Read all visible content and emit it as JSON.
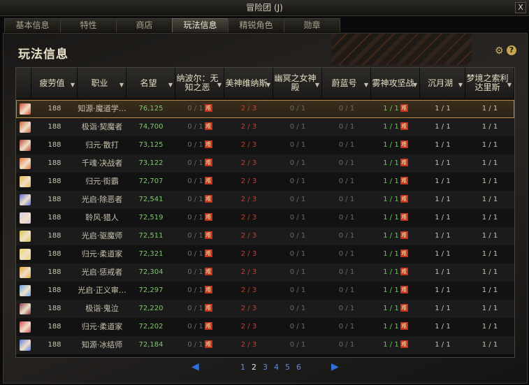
{
  "window": {
    "title": "冒险团 (J)",
    "close_label": "X"
  },
  "tabs": [
    {
      "label": "基本信息",
      "active": false
    },
    {
      "label": "特性",
      "active": false
    },
    {
      "label": "商店",
      "active": false
    },
    {
      "label": "玩法信息",
      "active": true
    },
    {
      "label": "精锐角色",
      "active": false
    },
    {
      "label": "勋章",
      "active": false
    }
  ],
  "panel": {
    "title": "玩法信息",
    "help_label": "?",
    "gear_icon": "gear-icon"
  },
  "columns": [
    {
      "label": "",
      "sortable": false
    },
    {
      "label": "疲劳值",
      "sortable": true
    },
    {
      "label": "职业",
      "sortable": true
    },
    {
      "label": "名望",
      "sortable": true
    },
    {
      "label": "纳波尔：无知之恶",
      "sortable": true
    },
    {
      "label": "美神维纳斯",
      "sortable": true
    },
    {
      "label": "幽冥之女神殿",
      "sortable": true
    },
    {
      "label": "蔚蓝号",
      "sortable": true
    },
    {
      "label": "雾神攻坚战",
      "sortable": true
    },
    {
      "label": "沉月湖",
      "sortable": true
    },
    {
      "label": "梦境之索利达里斯",
      "sortable": true
    }
  ],
  "badge_char": "难",
  "rows": [
    {
      "avatar_color": "#d84a3a",
      "fatigue": "188",
      "job": "知源·魔道学…",
      "fame": "76,125",
      "naboer": "0 / 1",
      "venus": "2 / 3",
      "hades": "0 / 1",
      "azure": "0 / 1",
      "mist": "1 / 1",
      "moonlake": "1 / 1",
      "dream": "1 / 1",
      "selected": true
    },
    {
      "avatar_color": "#c8643a",
      "fatigue": "188",
      "job": "极诣·契魔者",
      "fame": "74,700",
      "naboer": "0 / 1",
      "venus": "2 / 3",
      "hades": "0 / 1",
      "azure": "0 / 1",
      "mist": "1 / 1",
      "moonlake": "1 / 1",
      "dream": "1 / 1",
      "selected": false
    },
    {
      "avatar_color": "#b8483a",
      "fatigue": "188",
      "job": "归元·散打",
      "fame": "73,125",
      "naboer": "0 / 1",
      "venus": "2 / 3",
      "hades": "0 / 1",
      "azure": "0 / 1",
      "mist": "1 / 1",
      "moonlake": "1 / 1",
      "dream": "1 / 1",
      "selected": false
    },
    {
      "avatar_color": "#e07a3a",
      "fatigue": "188",
      "job": "千魂·决战者",
      "fame": "73,122",
      "naboer": "0 / 1",
      "venus": "2 / 3",
      "hades": "0 / 1",
      "azure": "0 / 1",
      "mist": "1 / 1",
      "moonlake": "1 / 1",
      "dream": "1 / 1",
      "selected": false
    },
    {
      "avatar_color": "#e8b84a",
      "fatigue": "188",
      "job": "归元·街霸",
      "fame": "72,707",
      "naboer": "0 / 1",
      "venus": "2 / 3",
      "hades": "0 / 1",
      "azure": "0 / 1",
      "mist": "1 / 1",
      "moonlake": "1 / 1",
      "dream": "1 / 1",
      "selected": false
    },
    {
      "avatar_color": "#5a6ad8",
      "fatigue": "188",
      "job": "光启·除恶者",
      "fame": "72,541",
      "naboer": "0 / 1",
      "venus": "2 / 3",
      "hades": "0 / 1",
      "azure": "0 / 1",
      "mist": "1 / 1",
      "moonlake": "1 / 1",
      "dream": "1 / 1",
      "selected": false
    },
    {
      "avatar_color": "#d8c8e8",
      "fatigue": "188",
      "job": "聆风·猎人",
      "fame": "72,519",
      "naboer": "0 / 1",
      "venus": "2 / 3",
      "hades": "0 / 1",
      "azure": "0 / 1",
      "mist": "1 / 1",
      "moonlake": "1 / 1",
      "dream": "1 / 1",
      "selected": false
    },
    {
      "avatar_color": "#d8c84a",
      "fatigue": "188",
      "job": "光启·驱魔师",
      "fame": "72,511",
      "naboer": "0 / 1",
      "venus": "2 / 3",
      "hades": "0 / 1",
      "azure": "0 / 1",
      "mist": "1 / 1",
      "moonlake": "1 / 1",
      "dream": "1 / 1",
      "selected": false
    },
    {
      "avatar_color": "#e8d86a",
      "fatigue": "188",
      "job": "归元·柔道家",
      "fame": "72,321",
      "naboer": "0 / 1",
      "venus": "2 / 3",
      "hades": "0 / 1",
      "azure": "0 / 1",
      "mist": "1 / 1",
      "moonlake": "1 / 1",
      "dream": "1 / 1",
      "selected": false
    },
    {
      "avatar_color": "#e8a83a",
      "fatigue": "188",
      "job": "光启·惩戒者",
      "fame": "72,304",
      "naboer": "0 / 1",
      "venus": "2 / 3",
      "hades": "0 / 1",
      "azure": "0 / 1",
      "mist": "1 / 1",
      "moonlake": "1 / 1",
      "dream": "1 / 1",
      "selected": false
    },
    {
      "avatar_color": "#6aa8e8",
      "fatigue": "188",
      "job": "光启·正义审…",
      "fame": "72,297",
      "naboer": "0 / 1",
      "venus": "2 / 3",
      "hades": "0 / 1",
      "azure": "0 / 1",
      "mist": "1 / 1",
      "moonlake": "1 / 1",
      "dream": "1 / 1",
      "selected": false
    },
    {
      "avatar_color": "#8a3a4a",
      "fatigue": "188",
      "job": "极诣·鬼泣",
      "fame": "72,220",
      "naboer": "0 / 1",
      "venus": "2 / 3",
      "hades": "0 / 1",
      "azure": "0 / 1",
      "mist": "1 / 1",
      "moonlake": "1 / 1",
      "dream": "1 / 1",
      "selected": false
    },
    {
      "avatar_color": "#d84a5a",
      "fatigue": "188",
      "job": "归元·柔道家",
      "fame": "72,202",
      "naboer": "0 / 1",
      "venus": "2 / 3",
      "hades": "0 / 1",
      "azure": "0 / 1",
      "mist": "1 / 1",
      "moonlake": "1 / 1",
      "dream": "1 / 1",
      "selected": false
    },
    {
      "avatar_color": "#5a7ae8",
      "fatigue": "188",
      "job": "知源·冰结师",
      "fame": "72,184",
      "naboer": "0 / 1",
      "venus": "2 / 3",
      "hades": "0 / 1",
      "azure": "0 / 1",
      "mist": "1 / 1",
      "moonlake": "1 / 1",
      "dream": "1 / 1",
      "selected": false
    }
  ],
  "pagination": {
    "prev_label": "◀",
    "next_label": "▶",
    "pages": [
      "1",
      "2",
      "3",
      "4",
      "5",
      "6"
    ],
    "current": "2"
  }
}
